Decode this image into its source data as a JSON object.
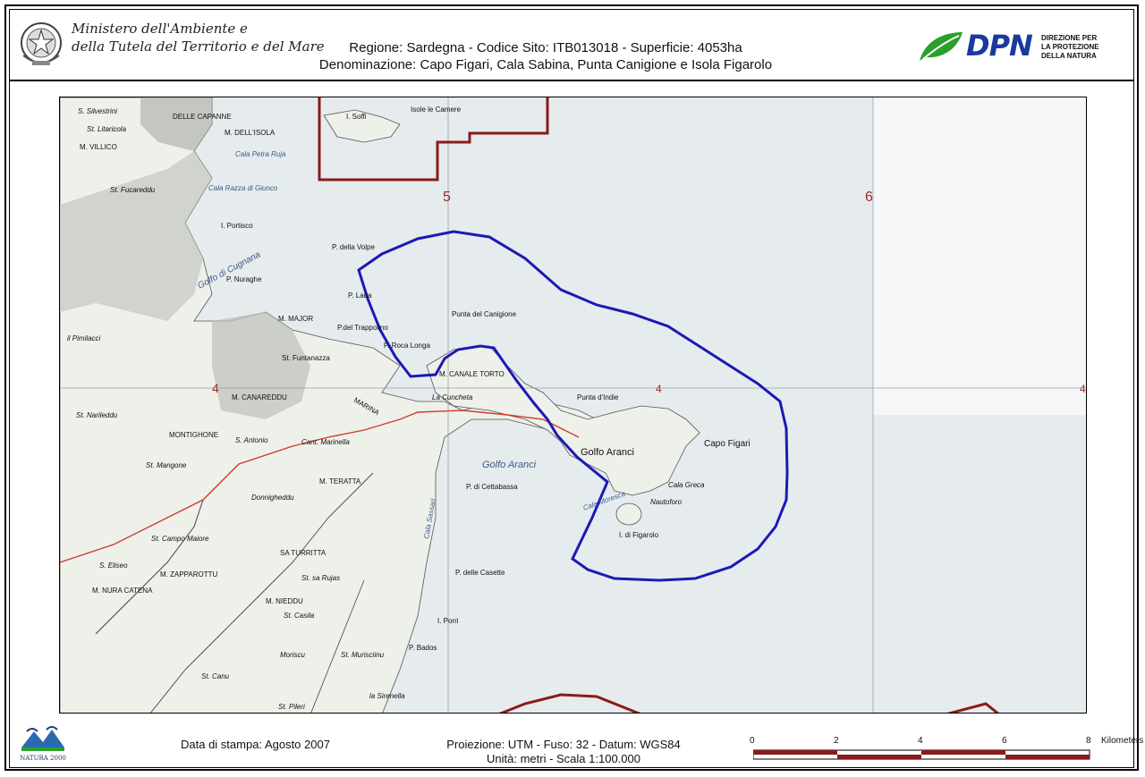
{
  "header": {
    "ministry_line1": "Ministero dell'Ambiente e",
    "ministry_line2": "della Tutela del Territorio e del Mare",
    "region_line1": "Regione: Sardegna - Codice Sito: ITB013018 - Superficie: 4053ha",
    "region_line2": "Denominazione: Capo Figari, Cala Sabina, Punta Canigione e Isola Figarolo",
    "dpn_logo_text": "DPN",
    "dpn_sub1": "DIREZIONE PER",
    "dpn_sub2": "LA PROTEZIONE",
    "dpn_sub3": "DELLA NATURA",
    "emblem_icon": "republic-emblem-icon",
    "dpn_leaf_icon": "leaf-icon"
  },
  "map": {
    "grid_labels": [
      "5",
      "6",
      "4",
      "4",
      "4"
    ],
    "sea_label": "Golfo Aranci",
    "site_boundary_color": "#1a1ab4",
    "adjacent_site_color": "#8b1a1a",
    "place_labels": {
      "soffi": "I. Soffi",
      "camere": "Isole le Camere",
      "capanne": "DELLE CAPANNE",
      "isola": "M. DELL'ISOLA",
      "petra_ruja": "Cala Petra Ruja",
      "razza": "Cala Razza di Giunco",
      "portisco": "I. Portisco",
      "volpe": "P. della Volpe",
      "cugnana": "Golfo di Cugnana",
      "nuraghe": "P. Nuraghe",
      "lada": "P. Lada",
      "major": "M. MAJOR",
      "trappolino": "P.del Trappolino",
      "canigione": "Punta del Canigione",
      "roca_longa": "P. Roca Longa",
      "canale_torto": "M. CANALE TORTO",
      "cuncheta": "La Cuncheta",
      "indie": "Punta d'Indie",
      "capo_figari": "Capo Figari",
      "golfo_aranci": "Golfo Aranci",
      "cala_greca": "Cala Greca",
      "nautoforo": "Nautoforo",
      "figarolo": "I. di Figarolo",
      "moresca": "Cala Moresca",
      "cettabassa": "P. di Cettabassa",
      "funtanazza": "St. Funtanazza",
      "canareddu": "M. CANAREDDU",
      "marina": "MARINA",
      "montighone": "MONTIGHONE",
      "s_antonio": "S. Antonio",
      "marinella": "Cant. Marinella",
      "teratta": "M. TERATTA",
      "mangone": "St. Mangone",
      "donnigheddu": "Donnigheddu",
      "campo_maiore": "St. Campo Maiore",
      "saturritta": "SA TURRITTA",
      "elisei": "S. Eliseo",
      "zapparottu": "M. ZAPPAROTTU",
      "nura_catena": "M. NURA CATENA",
      "rujas": "St. sa Rujas",
      "casette": "P. delle Casette",
      "nieddu": "M. NIEDDU",
      "casila": "St. Casila",
      "porri": "I. Porri",
      "bados": "P. Bados",
      "moriscu": "Moriscu",
      "murisciinu": "St. Murisciinu",
      "sirenella": "la Sirenella",
      "pileri": "St. Pileri",
      "canu": "St. Canu",
      "cala_sassari": "Cala Sassari",
      "villico": "M. VILLICO",
      "litaricola": "St. Litaricola",
      "fucareddu": "St. Fucareddu",
      "pimilacci": "il Pimilacci",
      "narileddu": "St. Narileddu",
      "silvestrini": "S. Silvestrini"
    }
  },
  "footer": {
    "natura_logo_text": "NATURA 2000",
    "print_date": "Data di stampa: Agosto 2007",
    "projection_line1": "Proiezione: UTM - Fuso: 32 - Datum: WGS84",
    "projection_line2": "Unità: metri - Scala 1:100.000",
    "scale_ticks": [
      "0",
      "2",
      "4",
      "6",
      "8"
    ],
    "scale_unit": "Kilometers",
    "scale_color": "#8b1a1a"
  }
}
